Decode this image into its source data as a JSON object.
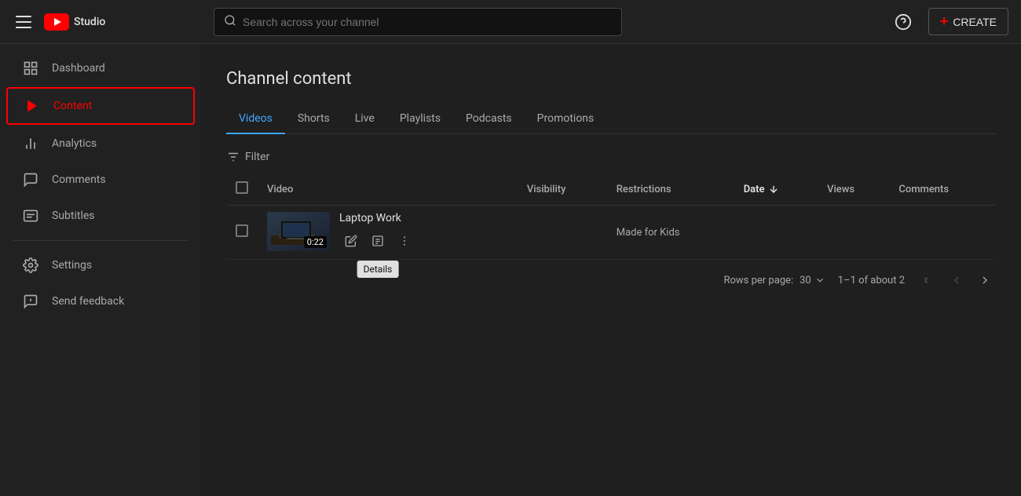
{
  "header": {
    "menu_icon": "☰",
    "logo_text": "Studio",
    "search_placeholder": "Search across your channel",
    "help_icon": "?",
    "create_label": "CREATE"
  },
  "sidebar": {
    "items": [
      {
        "id": "dashboard",
        "label": "Dashboard",
        "icon": "⊞"
      },
      {
        "id": "content",
        "label": "Content",
        "icon": "▶",
        "active": true
      },
      {
        "id": "analytics",
        "label": "Analytics",
        "icon": "📊"
      },
      {
        "id": "comments",
        "label": "Comments",
        "icon": "💬"
      },
      {
        "id": "subtitles",
        "label": "Subtitles",
        "icon": "⊟"
      }
    ],
    "bottom_items": [
      {
        "id": "settings",
        "label": "Settings",
        "icon": "⚙"
      },
      {
        "id": "feedback",
        "label": "Send feedback",
        "icon": "⚠"
      }
    ]
  },
  "page": {
    "title": "Channel content",
    "tabs": [
      {
        "id": "videos",
        "label": "Videos",
        "active": true
      },
      {
        "id": "shorts",
        "label": "Shorts",
        "active": false
      },
      {
        "id": "live",
        "label": "Live",
        "active": false
      },
      {
        "id": "playlists",
        "label": "Playlists",
        "active": false
      },
      {
        "id": "podcasts",
        "label": "Podcasts",
        "active": false
      },
      {
        "id": "promotions",
        "label": "Promotions",
        "active": false
      }
    ],
    "filter_label": "Filter",
    "table": {
      "columns": [
        {
          "id": "checkbox",
          "label": ""
        },
        {
          "id": "video",
          "label": "Video"
        },
        {
          "id": "visibility",
          "label": "Visibility"
        },
        {
          "id": "restrictions",
          "label": "Restrictions"
        },
        {
          "id": "date",
          "label": "Date",
          "sort": true
        },
        {
          "id": "views",
          "label": "Views"
        },
        {
          "id": "comments",
          "label": "Comments"
        }
      ],
      "rows": [
        {
          "id": "row-1",
          "title": "Laptop Work",
          "duration": "0:22",
          "visibility": "",
          "restrictions": "Made for Kids",
          "date": "",
          "views": "",
          "comments": ""
        }
      ]
    },
    "footer": {
      "rows_per_page_label": "Rows per page:",
      "rows_per_page_value": "30",
      "pagination_info": "1–1 of about 2"
    },
    "tooltip": {
      "details_label": "Details"
    }
  }
}
